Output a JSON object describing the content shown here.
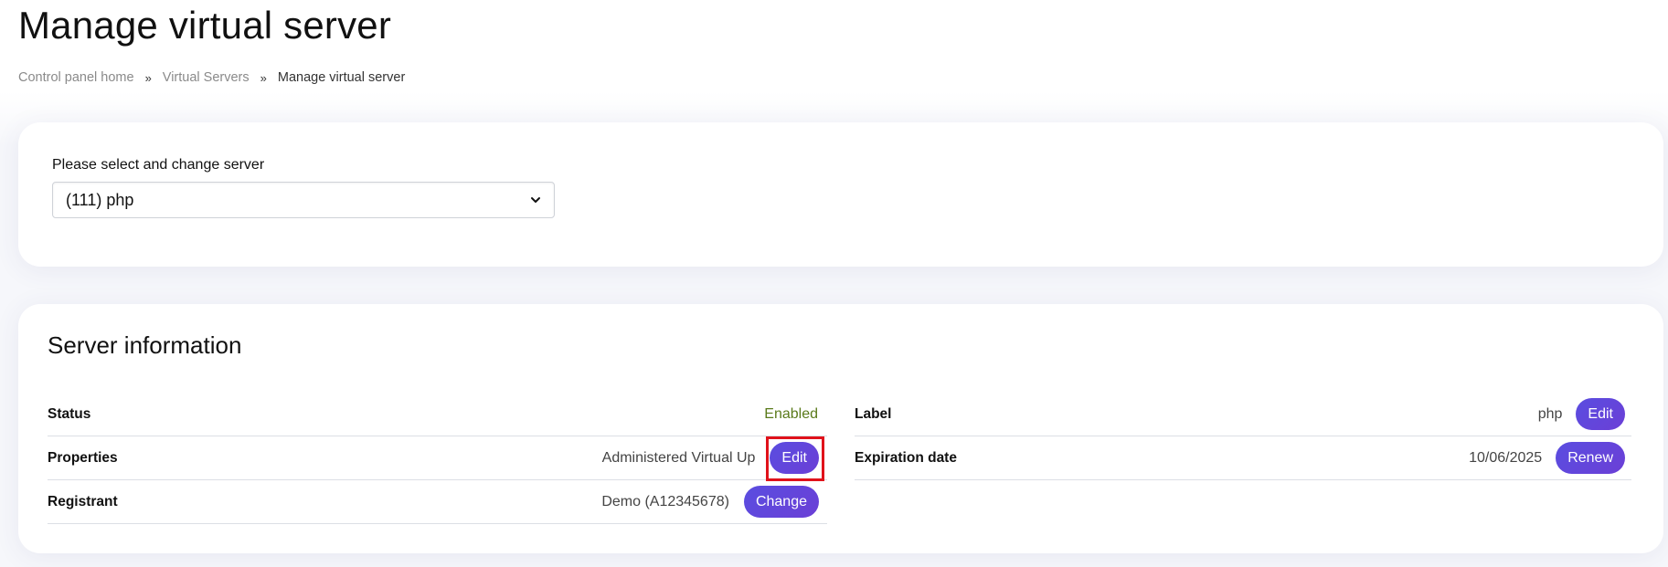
{
  "page": {
    "title": "Manage virtual server"
  },
  "breadcrumb": {
    "items": [
      "Control panel home",
      "Virtual Servers"
    ],
    "separator": "»",
    "current": "Manage virtual server"
  },
  "server_select": {
    "label": "Please select and change server",
    "selected": "(111) php",
    "icon": "chevron-down-icon"
  },
  "server_info": {
    "title": "Server information",
    "left_rows": [
      {
        "label": "Status",
        "value": "Enabled"
      },
      {
        "label": "Properties",
        "value": "Administered Virtual Up",
        "button": "Edit"
      },
      {
        "label": "Registrant",
        "value": "Demo (A12345678)",
        "button": "Change"
      }
    ],
    "right_rows": [
      {
        "label": "Label",
        "value": "php",
        "button": "Edit"
      },
      {
        "label": "Expiration date",
        "value": "10/06/2025",
        "button": "Renew"
      }
    ]
  },
  "colors": {
    "button_gradient_start": "#5a4de0",
    "button_gradient_end": "#6b3fd6",
    "status_enabled": "#5a7a1a",
    "highlight_border": "#e0121b"
  }
}
